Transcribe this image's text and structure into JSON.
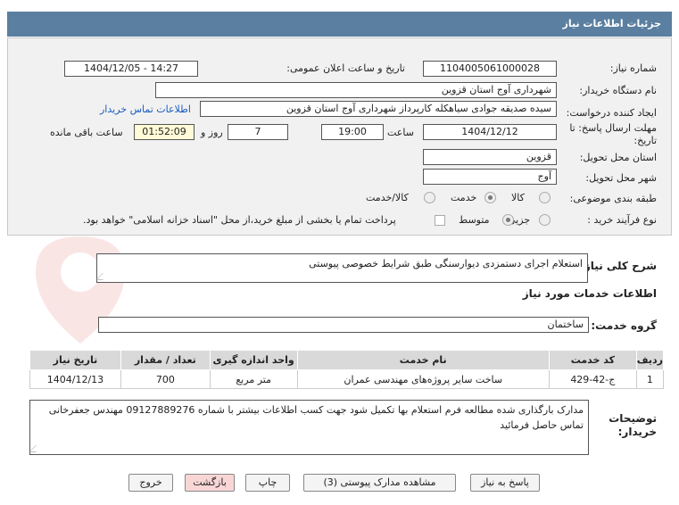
{
  "header": {
    "title": "جزئیات اطلاعات نیاز"
  },
  "form": {
    "need_number_label": "شماره نیاز:",
    "need_number": "1104005061000028",
    "announce_label": "تاریخ و ساعت اعلان عمومی:",
    "announce_value": "1404/12/05 - 14:27",
    "buyer_org_label": "نام دستگاه خریدار:",
    "buyer_org": "شهرداری آوج استان قزوین",
    "creator_label": "ایجاد کننده درخواست:",
    "creator": "سیده صدیقه جوادی سیاهکله کارپرداز شهرداری آوج استان قزوین",
    "contact_link": "اطلاعات تماس خریدار",
    "deadline_label_1": "مهلت ارسال پاسخ: تا",
    "deadline_label_2": "تاریخ:",
    "deadline_date": "1404/12/12",
    "time_label": "ساعت",
    "deadline_time": "19:00",
    "days_value": "7",
    "days_label": "روز و",
    "remaining_time": "01:52:09",
    "remaining_label": "ساعت باقی مانده",
    "province_label": "استان محل تحویل:",
    "province": "قزوین",
    "city_label": "شهر محل تحویل:",
    "city": "آوج",
    "category_label": "طبقه بندی موضوعی:",
    "category_options": [
      "کالا",
      "خدمت",
      "کالا/خدمت"
    ],
    "process_label": "نوع فرآیند خرید :",
    "process_options": [
      "جزیی",
      "متوسط"
    ],
    "treasury_note": "پرداخت تمام یا بخشی از مبلغ خرید،از محل \"اسناد خزانه اسلامی\" خواهد بود."
  },
  "summary": {
    "label": "شرح کلی نیاز:",
    "value": "استعلام اجرای دستمزدی دیوارسنگی طبق شرایط خصوصی پیوستی"
  },
  "services": {
    "section_title": "اطلاعات خدمات مورد نیاز",
    "group_label": "گروه خدمت:",
    "group_value": "ساختمان",
    "columns": [
      "ردیف",
      "کد خدمت",
      "نام خدمت",
      "واحد اندازه گیری",
      "تعداد / مقدار",
      "تاریخ نیاز"
    ],
    "rows": [
      {
        "row": "1",
        "code": "ج-42-429",
        "name": "ساخت سایر پروژه‌های مهندسی عمران",
        "unit": "متر مربع",
        "qty": "700",
        "date": "1404/12/13"
      }
    ]
  },
  "notes": {
    "label_1": "توضیحات",
    "label_2": "خریدار:",
    "value": "مدارک بارگذاری شده مطالعه فرم استعلام بها تکمیل شود جهت کسب اطلاعات بیشتر با شماره 09127889276 مهندس جعفرخانی تماس حاصل فرمائید"
  },
  "buttons": {
    "reply": "پاسخ به نیاز",
    "attachments": "مشاهده مدارک پیوستی (3)",
    "print": "چاپ",
    "back": "بازگشت",
    "exit": "خروج"
  },
  "colors": {
    "header_bg": "#5a7fa0",
    "panel_bg": "#f1f1f1",
    "link": "#1a5bbf",
    "back_button": "#f9d6d6"
  }
}
